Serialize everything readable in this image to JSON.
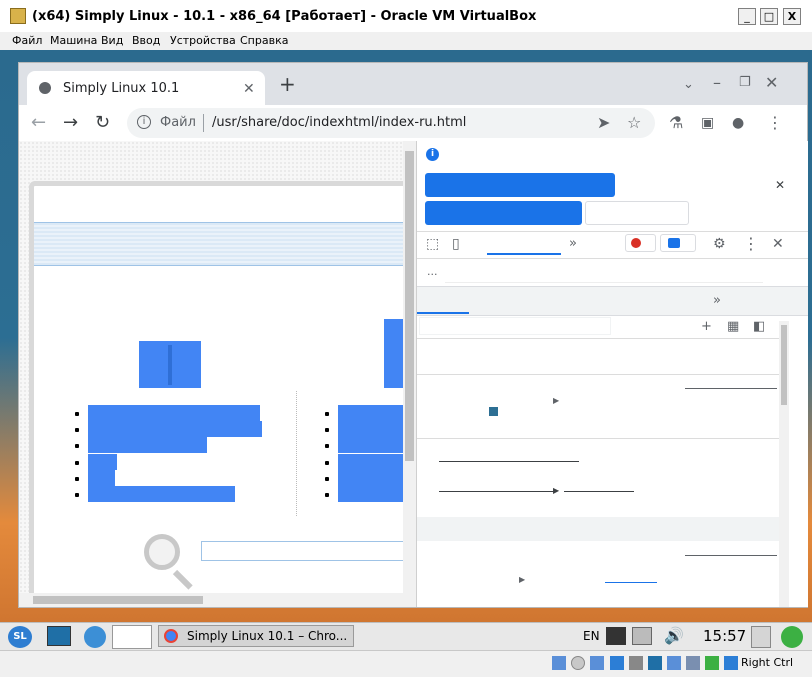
{
  "window": {
    "title": "(x64) Simply Linux - 10.1 - x86_64 [Работает] - Oracle VM VirtualBox",
    "min_label": "_",
    "max_label": "□",
    "close_label": "X"
  },
  "menu": {
    "file": "Файл",
    "machine": "Машина",
    "view": "Вид",
    "input": "Ввод",
    "devices": "Устройства",
    "help": "Справка"
  },
  "browser": {
    "tab_title": "Simply Linux 10.1",
    "address_scheme": "Файл",
    "address_path": "/usr/share/doc/indexhtml/index-ru.html"
  },
  "taskbar": {
    "task_label": "Simply Linux 10.1 – Chro...",
    "lang": "EN",
    "clock": "15:57"
  },
  "status": {
    "host_key": "Right Ctrl"
  },
  "colors": {
    "accent": "#4285f4",
    "devtools_accent": "#1a73e8"
  }
}
